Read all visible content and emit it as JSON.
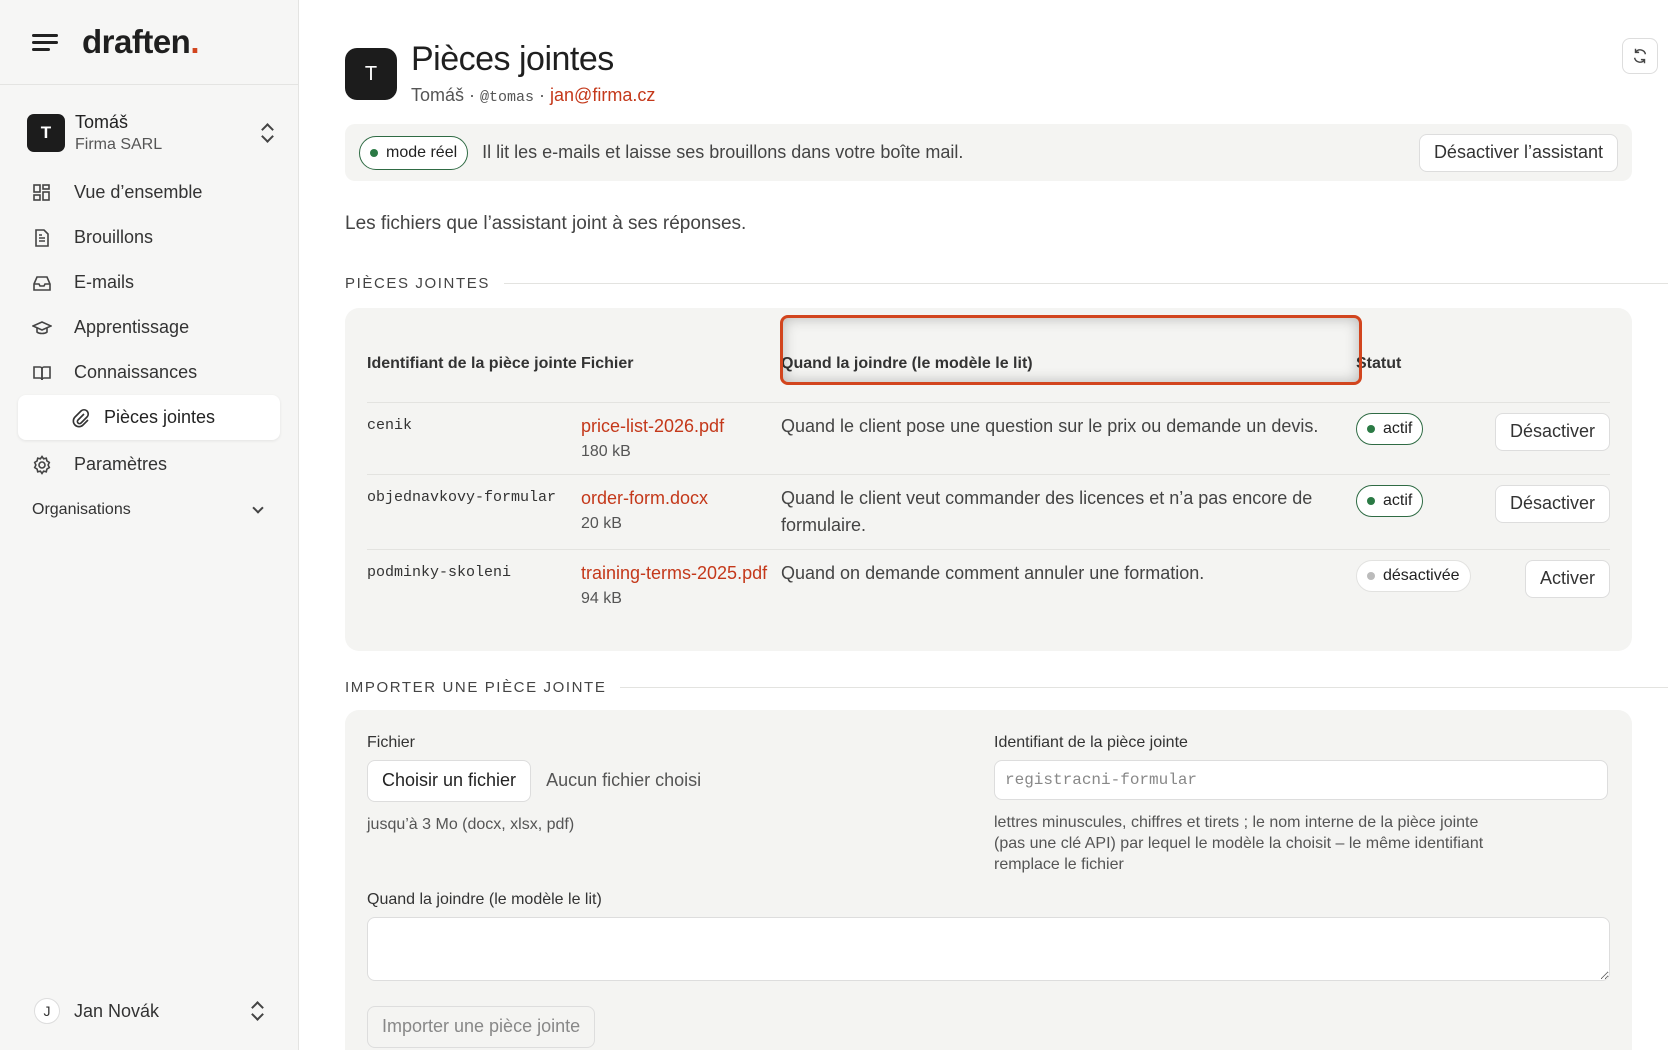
{
  "brand": {
    "name": "draften",
    "dot": ".",
    "accent": "#d2451e"
  },
  "org": {
    "avatar": "T",
    "name": "Tomáš",
    "company": "Firma SARL"
  },
  "nav": [
    {
      "label": "Vue d’ensemble",
      "icon": "dashboard-icon"
    },
    {
      "label": "Brouillons",
      "icon": "document-icon"
    },
    {
      "label": "E-mails",
      "icon": "inbox-icon"
    },
    {
      "label": "Apprentissage",
      "icon": "graduation-cap-icon"
    },
    {
      "label": "Connaissances",
      "icon": "book-icon"
    },
    {
      "label": "Pièces jointes",
      "icon": "paperclip-icon",
      "active": true
    },
    {
      "label": "Paramètres",
      "icon": "gear-icon"
    }
  ],
  "organisations_label": "Organisations",
  "user": {
    "avatar": "J",
    "name": "Jan Novák"
  },
  "header": {
    "avatar": "T",
    "title": "Pièces jointes",
    "name": "Tomáš",
    "sep1": " · ",
    "handle": "@tomas",
    "sep2": " · ",
    "email": "jan@firma.cz"
  },
  "banner": {
    "mode": "mode réel",
    "text": "Il lit les e-mails et laisse ses brouillons dans votre boîte mail.",
    "button": "Désactiver l’assistant"
  },
  "intro": "Les fichiers que l’assistant joint à ses réponses.",
  "attachments_section": "PIÈCES JOINTES",
  "table": {
    "headers": [
      "Identifiant de la pièce jointe",
      "Fichier",
      "Quand la joindre (le modèle le lit)",
      "Statut"
    ],
    "rows": [
      {
        "id": "cenik",
        "file": "price-list-2026.pdf",
        "size": "180 kB",
        "when": "Quand le client pose une question sur le prix ou demande un devis.",
        "status": "actif",
        "active": true,
        "action": "Désactiver"
      },
      {
        "id": "objednavkovy-formular",
        "file": "order-form.docx",
        "size": "20 kB",
        "when": "Quand le client veut commander des licences et n’a pas encore de formulaire.",
        "status": "actif",
        "active": true,
        "action": "Désactiver"
      },
      {
        "id": "podminky-skoleni",
        "file": "training-terms-2025.pdf",
        "size": "94 kB",
        "when": "Quand on demande comment annuler une formation.",
        "status": "désactivée",
        "active": false,
        "action": "Activer"
      }
    ]
  },
  "upload": {
    "section": "IMPORTER UNE PIÈCE JOINTE",
    "file_label": "Fichier",
    "file_button": "Choisir un fichier",
    "file_none": "Aucun fichier choisi",
    "file_hint": "jusqu’à 3 Mo (docx, xlsx, pdf)",
    "id_label": "Identifiant de la pièce jointe",
    "id_placeholder": "registracni-formular",
    "id_hint": "lettres minuscules, chiffres et tirets ; le nom interne de la pièce jointe (pas une clé API) par lequel le modèle la choisit – le même identifiant remplace le fichier",
    "when_label": "Quand la joindre (le modèle le lit)",
    "submit": "Importer une pièce jointe"
  }
}
